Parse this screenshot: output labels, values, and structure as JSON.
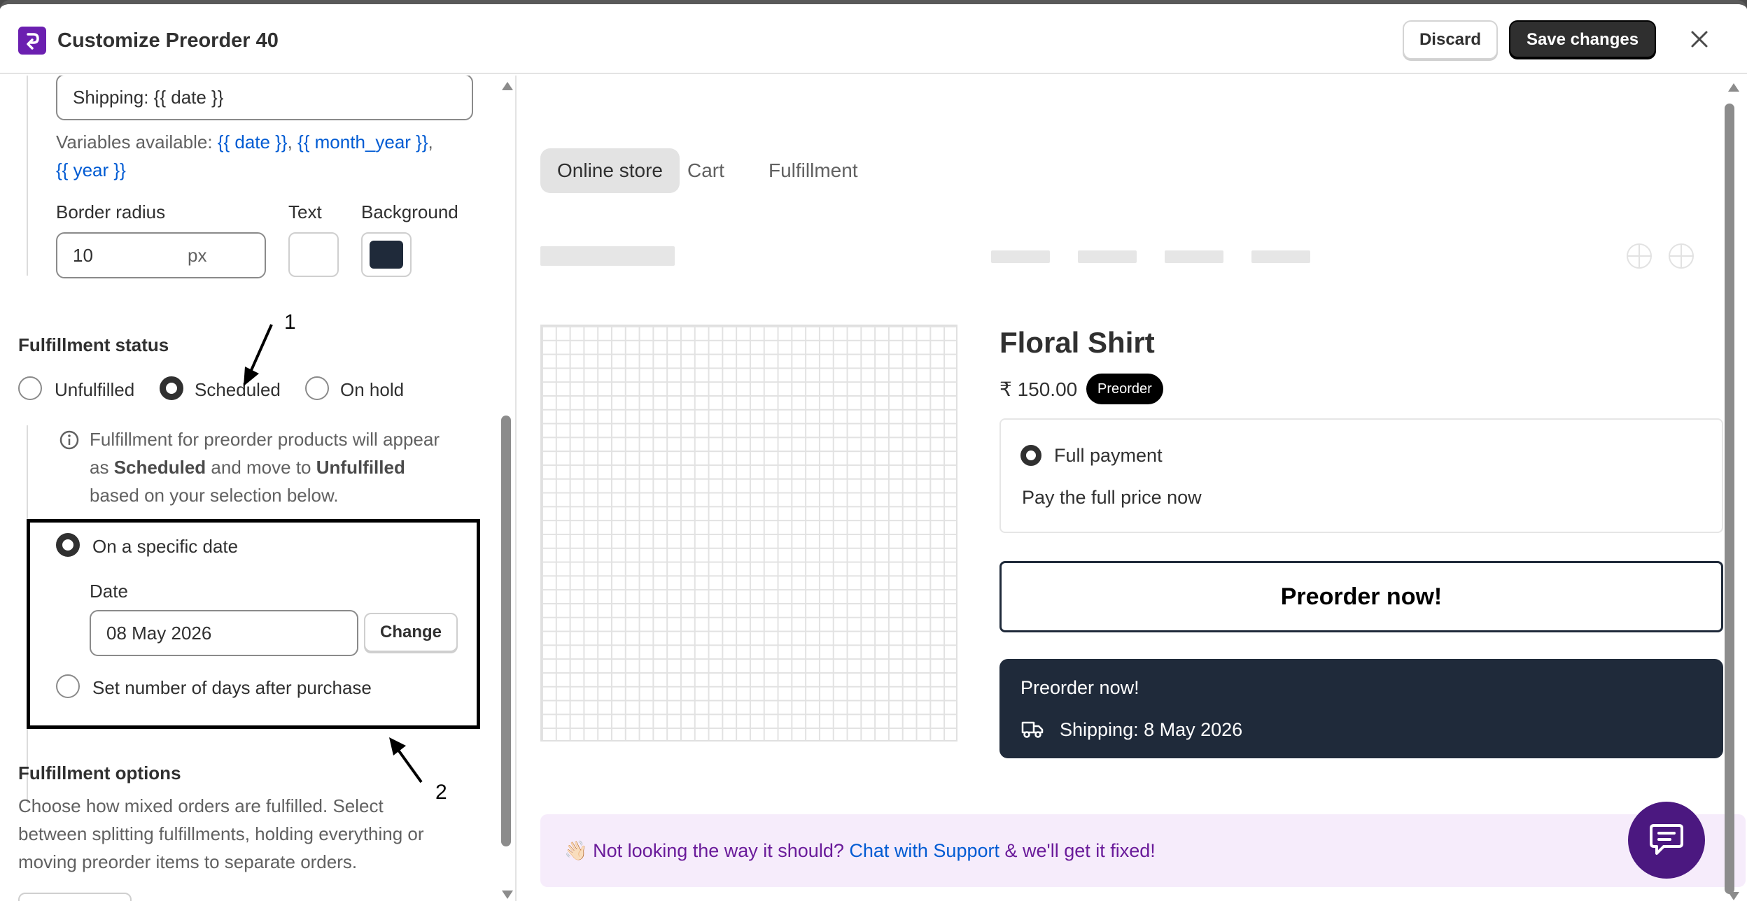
{
  "header": {
    "title": "Customize Preorder 40",
    "discard_label": "Discard",
    "save_label": "Save changes"
  },
  "left": {
    "shipping_input_value": "Shipping: {{ date }}",
    "variables_prefix": "Variables available:",
    "variables": [
      "{{ date }}",
      "{{ month_year }}",
      "{{ year }}"
    ],
    "border_radius_label": "Border radius",
    "border_radius_value": "10",
    "border_radius_unit": "px",
    "text_label": "Text",
    "background_label": "Background",
    "background_color": "#1f2a3a",
    "fulfillment_status_title": "Fulfillment status",
    "status_options": [
      "Unfulfilled",
      "Scheduled",
      "On hold"
    ],
    "selected_status": "Scheduled",
    "info_line1": "Fulfillment for preorder products will appear",
    "info_as": "as",
    "info_scheduled": "Scheduled",
    "info_move_to": "and move to",
    "info_unfulfilled": "Unfulfilled",
    "info_line3": "based on your selection below.",
    "schedule_option_date": "On a specific date",
    "date_label": "Date",
    "date_value": "08 May 2026",
    "change_label": "Change",
    "schedule_option_days": "Set number of days after purchase",
    "fulfillment_options_title": "Fulfillment options",
    "fulfillment_options_desc": [
      "Choose how mixed orders are fulfilled. Select",
      "between splitting fulfillments, holding everything or",
      "moving preorder items to separate orders."
    ],
    "annotation_1": "1",
    "annotation_2": "2"
  },
  "preview": {
    "tabs": [
      "Online store",
      "Cart",
      "Fulfillment"
    ],
    "active_tab": "Online store",
    "product_title": "Floral Shirt",
    "price": "₹ 150.00",
    "badge": "Preorder",
    "payment_option": "Full payment",
    "payment_desc": "Pay the full price now",
    "preorder_button": "Preorder now!",
    "dark_button_title": "Preorder now!",
    "dark_button_shipping": "Shipping: 8 May 2026",
    "support_prefix": "Not looking the way it should?",
    "support_link": "Chat with Support",
    "support_suffix": "& we'll get it fixed!",
    "support_emoji": "👋🏻"
  },
  "colors": {
    "brand": "#6b1fb0",
    "link": "#005bd3",
    "dark_button": "#1f2a3a",
    "support_bg": "#f6ecfb",
    "support_text": "#6a1b9a",
    "chat_fab": "#4b1880"
  }
}
